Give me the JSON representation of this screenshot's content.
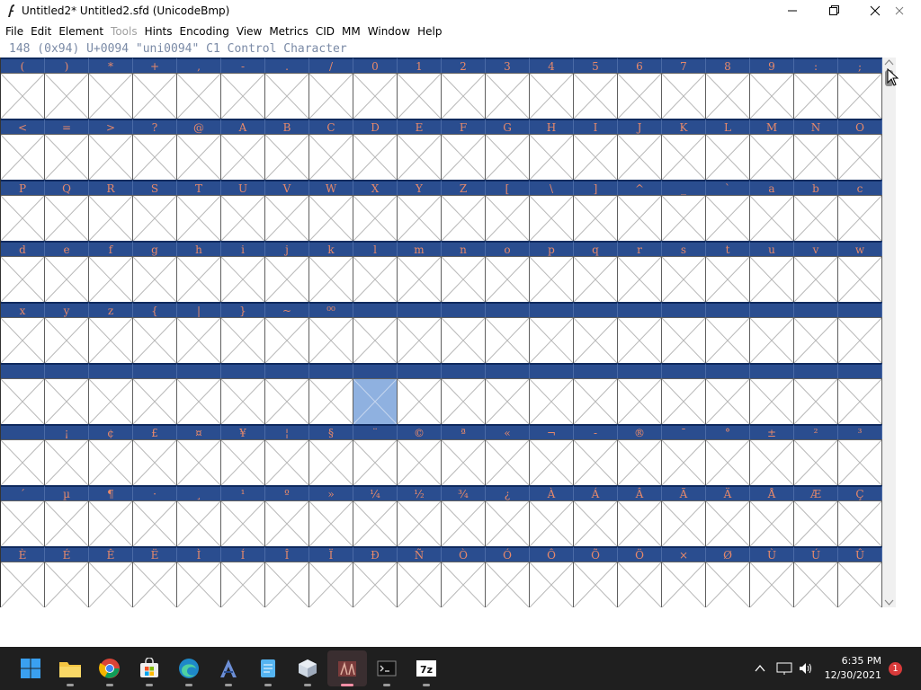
{
  "window": {
    "title": "Untitled2*  Untitled2.sfd (UnicodeBmp)",
    "controls": [
      "minimize-icon",
      "maximize-icon",
      "close-icon"
    ]
  },
  "menu": [
    "File",
    "Edit",
    "Element",
    "Tools",
    "Hints",
    "Encoding",
    "View",
    "Metrics",
    "CID",
    "MM",
    "Window",
    "Help"
  ],
  "menu_disabled": [
    "Tools"
  ],
  "info_line": "148 (0x94) U+0094 \"uni0094\" C1 Control Character",
  "grid": {
    "columns": 20,
    "selected_row": 5,
    "selected_col": 8,
    "rows": [
      [
        "(",
        ")",
        "*",
        "+",
        ",",
        "-",
        ".",
        "/",
        "0",
        "1",
        "2",
        "3",
        "4",
        "5",
        "6",
        "7",
        "8",
        "9",
        ":",
        ";"
      ],
      [
        "<",
        "=",
        ">",
        "?",
        "@",
        "A",
        "B",
        "C",
        "D",
        "E",
        "F",
        "G",
        "H",
        "I",
        "J",
        "K",
        "L",
        "M",
        "N",
        "O"
      ],
      [
        "P",
        "Q",
        "R",
        "S",
        "T",
        "U",
        "V",
        "W",
        "X",
        "Y",
        "Z",
        "[",
        "\\",
        "]",
        "^",
        "_",
        "`",
        "a",
        "b",
        "c"
      ],
      [
        "d",
        "e",
        "f",
        "g",
        "h",
        "i",
        "j",
        "k",
        "l",
        "m",
        "n",
        "o",
        "p",
        "q",
        "r",
        "s",
        "t",
        "u",
        "v",
        "w"
      ],
      [
        "x",
        "y",
        "z",
        "{",
        "|",
        "}",
        "~",
        "⁰⁰",
        "",
        "",
        "",
        "",
        "",
        "",
        "",
        "",
        "",
        "",
        "",
        ""
      ],
      [
        "",
        "",
        "",
        "",
        "",
        "",
        "",
        "",
        "",
        "",
        "",
        "",
        "",
        "",
        "",
        "",
        "",
        "",
        "",
        ""
      ],
      [
        "",
        "¡",
        "¢",
        "£",
        "¤",
        "¥",
        "¦",
        "§",
        "¨",
        "©",
        "ª",
        "«",
        "¬",
        "-",
        "®",
        "¯",
        "°",
        "±",
        "²",
        "³"
      ],
      [
        "´",
        "µ",
        "¶",
        "·",
        "¸",
        "¹",
        "º",
        "»",
        "¼",
        "½",
        "¾",
        "¿",
        "À",
        "Á",
        "Â",
        "Ã",
        "Ä",
        "Å",
        "Æ",
        "Ç"
      ],
      [
        "È",
        "É",
        "Ê",
        "Ë",
        "Ì",
        "Í",
        "Î",
        "Ï",
        "Ð",
        "Ñ",
        "Ò",
        "Ó",
        "Ô",
        "Õ",
        "Ö",
        "×",
        "Ø",
        "Ù",
        "Ú",
        "Û"
      ]
    ]
  },
  "taskbar": {
    "apps": [
      "windows-start-icon",
      "file-explorer-icon",
      "chrome-icon",
      "store-icon",
      "edge-icon",
      "fontforge-a-icon",
      "notepad-icon",
      "cube-icon",
      "fontforge-icon",
      "terminal-icon",
      "7zip-icon"
    ],
    "clock_time": "6:35 PM",
    "clock_date": "12/30/2021",
    "notification_count": "1",
    "colors": {
      "taskbar_bg": "#1f1f1f",
      "accent": "#2a4d8f",
      "badge": "#d83a3a"
    }
  }
}
